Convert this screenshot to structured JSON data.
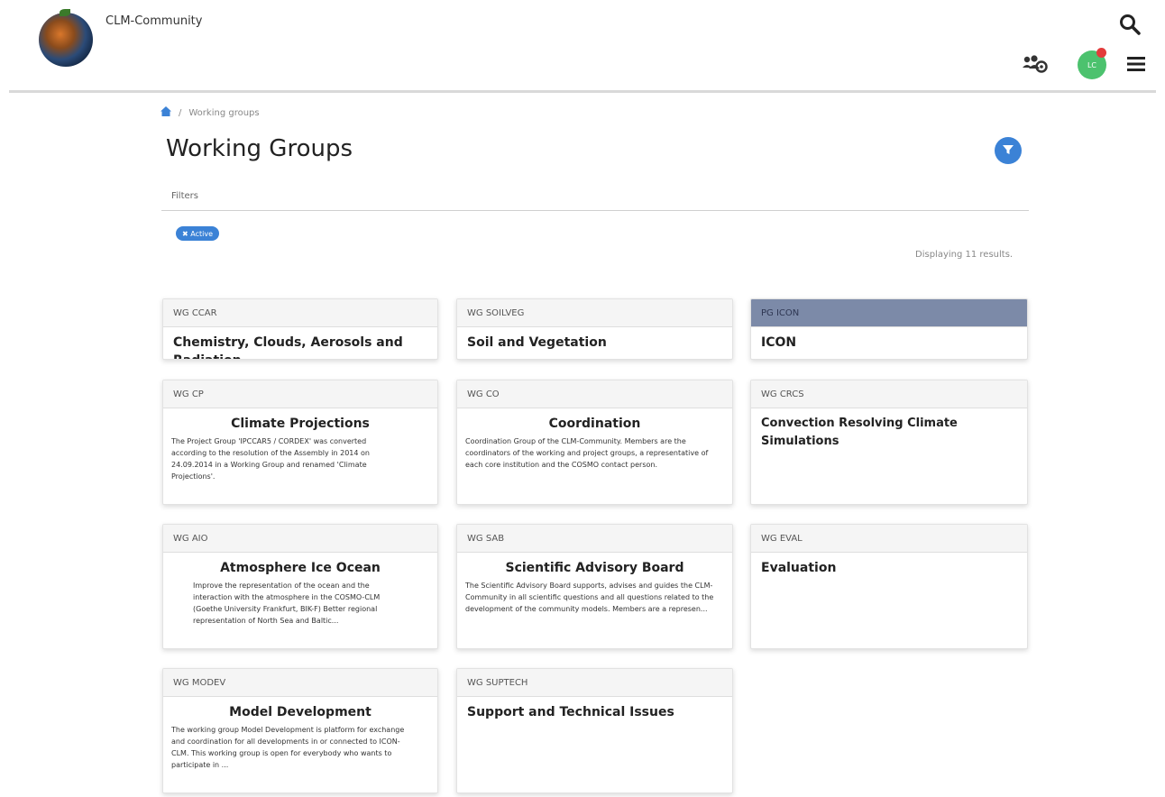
{
  "header": {
    "site_name": "CLM-Community",
    "avatar_initials": "LC"
  },
  "breadcrumb": {
    "current": "Working groups"
  },
  "page": {
    "title": "Working Groups",
    "filters_label": "Filters",
    "active_chip": "✖ Active",
    "results": "Displaying 11 results."
  },
  "colors": {
    "accent": "#3b82d6",
    "highlight_header": "#7c8aa8",
    "avatar": "#4cc26e"
  },
  "cards": [
    {
      "code": "WG CCAR",
      "title": "Chemistry, Clouds, Aerosols and Radiation",
      "description": ""
    },
    {
      "code": "WG SOILVEG",
      "title": "Soil and Vegetation",
      "description": ""
    },
    {
      "code": "PG ICON",
      "title": "ICON",
      "description": ""
    },
    {
      "code": "WG CP",
      "title": "Climate Projections",
      "description": "The Project Group 'IPCCAR5 / CORDEX' was converted according to the resolution of the Assembly in 2014 on 24.09.2014 in a Working Group and renamed 'Climate Projections'."
    },
    {
      "code": "WG CO",
      "title": "Coordination",
      "description": "Coordination Group of the CLM-Community. Members are the coordinators of the working and project groups, a representative of each core institution and the COSMO contact person."
    },
    {
      "code": "WG CRCS",
      "title": "Convection Resolving Climate Simulations",
      "description": ""
    },
    {
      "code": "WG AIO",
      "title": "Atmosphere Ice Ocean",
      "description": "Improve the representation of the ocean and the interaction with the atmosphere in the COSMO-CLM (Goethe University Frankfurt, BIK-F) Better regional representation of North Sea and Baltic..."
    },
    {
      "code": "WG SAB",
      "title": "Scientific Advisory Board",
      "description": "The Scientific Advisory Board supports, advises and guides the CLM-Community in all scientific questions and all questions related to the development of the community models. Members are a represen..."
    },
    {
      "code": "WG EVAL",
      "title": "Evaluation",
      "description": ""
    },
    {
      "code": "WG MODEV",
      "title": "Model Development",
      "description": "The working group Model Development is platform for exchange and coordination for all developments in or connected to ICON-CLM. This working group is open for everybody who wants to participate in ..."
    },
    {
      "code": "WG SUPTECH",
      "title": "Support and Technical Issues",
      "description": ""
    }
  ]
}
